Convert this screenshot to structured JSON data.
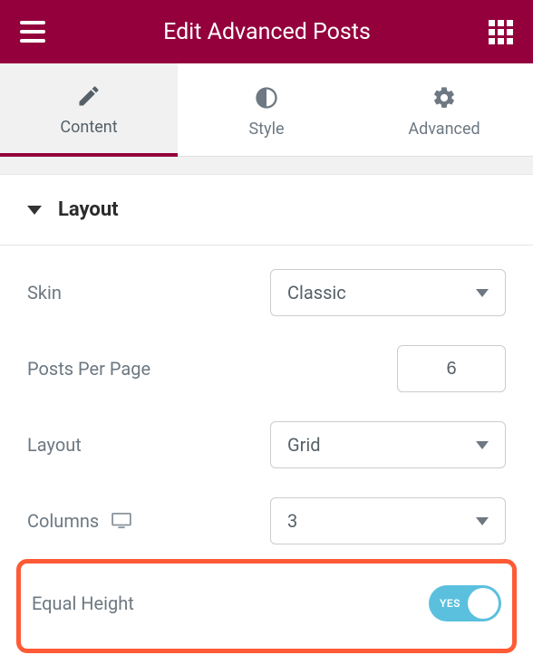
{
  "header": {
    "title": "Edit Advanced Posts"
  },
  "tabs": {
    "content": "Content",
    "style": "Style",
    "advanced": "Advanced"
  },
  "section": {
    "title": "Layout"
  },
  "controls": {
    "skin": {
      "label": "Skin",
      "value": "Classic"
    },
    "posts_per_page": {
      "label": "Posts Per Page",
      "value": "6"
    },
    "layout": {
      "label": "Layout",
      "value": "Grid"
    },
    "columns": {
      "label": "Columns",
      "value": "3"
    },
    "equal_height": {
      "label": "Equal Height",
      "toggle": "YES"
    }
  }
}
